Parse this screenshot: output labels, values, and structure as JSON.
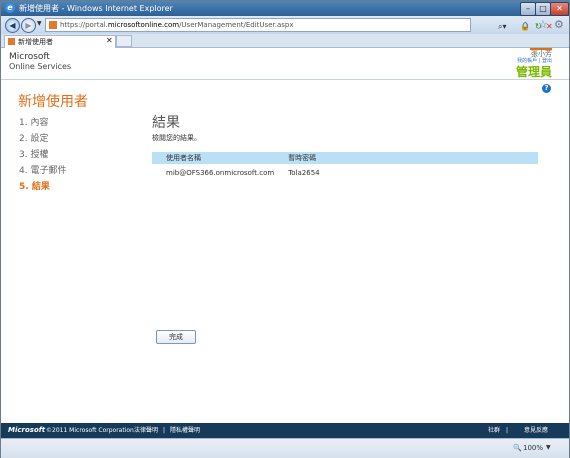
{
  "window": {
    "title": "新增使用者 - Windows Internet Explorer"
  },
  "browser": {
    "url_prefix": "https://portal.",
    "url_domain": "microsoftonline.com",
    "url_path": "/UserManagement/EditUser.aspx",
    "tab_label": "新增使用者",
    "zoom": "100%"
  },
  "header": {
    "logo_line1": "Microsoft",
    "logo_line2": "Online Services",
    "user_name": "張小芳",
    "user_links": "我的帳戶 | 登出",
    "admin_label": "管理員"
  },
  "page": {
    "heading": "新增使用者",
    "steps": [
      {
        "label": "1. 內容"
      },
      {
        "label": "2. 設定"
      },
      {
        "label": "3. 授權"
      },
      {
        "label": "4. 電子郵件"
      },
      {
        "label": "5. 結果"
      }
    ],
    "section_title": "結果",
    "section_desc": "檢閱您的結果。",
    "table": {
      "headers": [
        "使用者名稱",
        "暫時密碼"
      ],
      "rows": [
        [
          "mib@OFS366.onmicrosoft.com",
          "Tola2654"
        ]
      ]
    },
    "done_button": "完成"
  },
  "footer": {
    "logo": "Microsoft",
    "copyright": "©2011 Microsoft Corporation",
    "legal": "法律聲明",
    "separator": "|",
    "privacy": "隱私權聲明",
    "community": "社群",
    "feedback": "意見反應"
  },
  "colors": {
    "accent": "#e06f1a",
    "table_header": "#b9e0f5",
    "footer_bg": "#163a5a",
    "admin": "#7ab800"
  },
  "icons": [
    "ie-logo-icon",
    "back-icon",
    "forward-icon",
    "search-icon",
    "lock-icon",
    "refresh-icon",
    "stop-icon",
    "home-icon",
    "favorites-icon",
    "tools-icon",
    "help-icon",
    "zoom-icon"
  ]
}
